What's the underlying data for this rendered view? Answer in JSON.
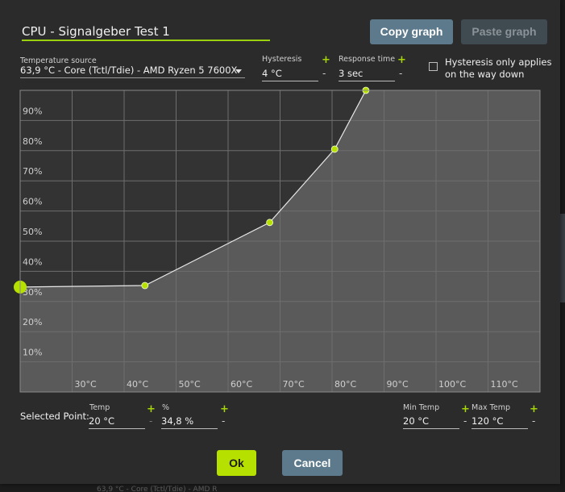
{
  "dialog": {
    "title_value": "CPU - Signalgeber Test 1",
    "copy_graph_label": "Copy graph",
    "paste_graph_label": "Paste graph"
  },
  "source": {
    "label": "Temperature source",
    "value": "63,9 °C - Core (Tctl/Tdie) - AMD Ryzen 5 7600X"
  },
  "hysteresis": {
    "label": "Hysteresis",
    "value": "4 °C",
    "plus": "+",
    "minus": "-"
  },
  "response": {
    "label": "Response time",
    "value": "3 sec",
    "plus": "+",
    "minus": "-"
  },
  "hysteresis_down": {
    "checked": false,
    "line1": "Hysteresis only applies",
    "line2": "on the way down"
  },
  "chart_data": {
    "type": "area",
    "x_ticks": [
      "30°C",
      "40°C",
      "50°C",
      "60°C",
      "70°C",
      "80°C",
      "90°C",
      "100°C",
      "110°C"
    ],
    "y_ticks": [
      "10%",
      "20%",
      "30%",
      "40%",
      "50%",
      "60%",
      "70%",
      "80%",
      "90%"
    ],
    "xlim": [
      20,
      120
    ],
    "ylim": [
      0,
      100
    ],
    "grid": true,
    "points": [
      {
        "x": 20,
        "y": 34.8
      },
      {
        "x": 44,
        "y": 35.3
      },
      {
        "x": 68,
        "y": 56.2
      },
      {
        "x": 80.5,
        "y": 80.5
      },
      {
        "x": 86.5,
        "y": 100
      }
    ],
    "selected_index": 0,
    "colors": {
      "background": "#333333",
      "fill": "#5a5a5a",
      "grid": "#6e6e6e",
      "line": "#e8e8e8",
      "point": "#b5e000"
    }
  },
  "selected": {
    "label": "Selected Point:",
    "temp_label": "Temp",
    "temp_value": "20 °C",
    "pct_label": "%",
    "pct_value": "34,8 %",
    "plus": "+",
    "minus": "-"
  },
  "limits": {
    "min_label": "Min Temp",
    "min_value": "20 °C",
    "max_label": "Max Temp",
    "max_value": "120 °C",
    "plus": "+",
    "minus": "-"
  },
  "footer": {
    "ok_label": "Ok",
    "cancel_label": "Cancel"
  },
  "background_text": "63,9 °C - Core (Tctl/Tdie) - AMD R"
}
